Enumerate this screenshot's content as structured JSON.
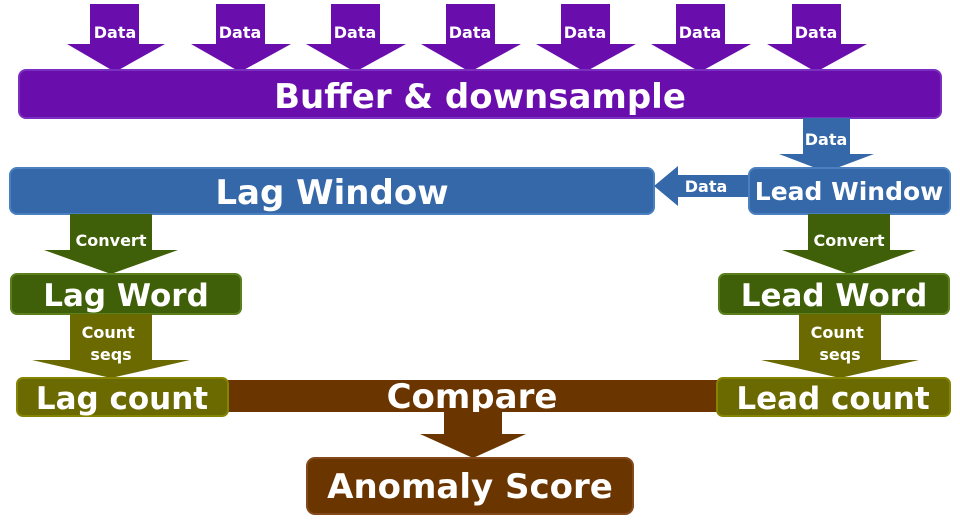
{
  "colors": {
    "purple": "#6a0dad",
    "purple_stroke": "#7b2fc0",
    "blue": "#3568a8",
    "blue_stroke": "#4a7fc0",
    "green": "#3f6008",
    "green_stroke": "#5a7f1c",
    "olive": "#6b6a00",
    "olive_stroke": "#858400",
    "brown": "#6b3500",
    "brown_stroke": "#83491a"
  },
  "inputs": {
    "label": "Data",
    "count": 7
  },
  "boxes": {
    "buffer": "Buffer & downsample",
    "lag_window": "Lag Window",
    "lead_window": "Lead Window",
    "lag_word": "Lag Word",
    "lead_word": "Lead Word",
    "lag_count": "Lag count",
    "lead_count": "Lead count",
    "compare": "Compare",
    "anomaly_score": "Anomaly Score"
  },
  "arrows": {
    "buffer_to_lead": "Data",
    "lead_to_lag": "Data",
    "lag_convert": "Convert",
    "lead_convert": "Convert",
    "lag_count_seqs": [
      "Count",
      "seqs"
    ],
    "lead_count_seqs": [
      "Count",
      "seqs"
    ]
  }
}
